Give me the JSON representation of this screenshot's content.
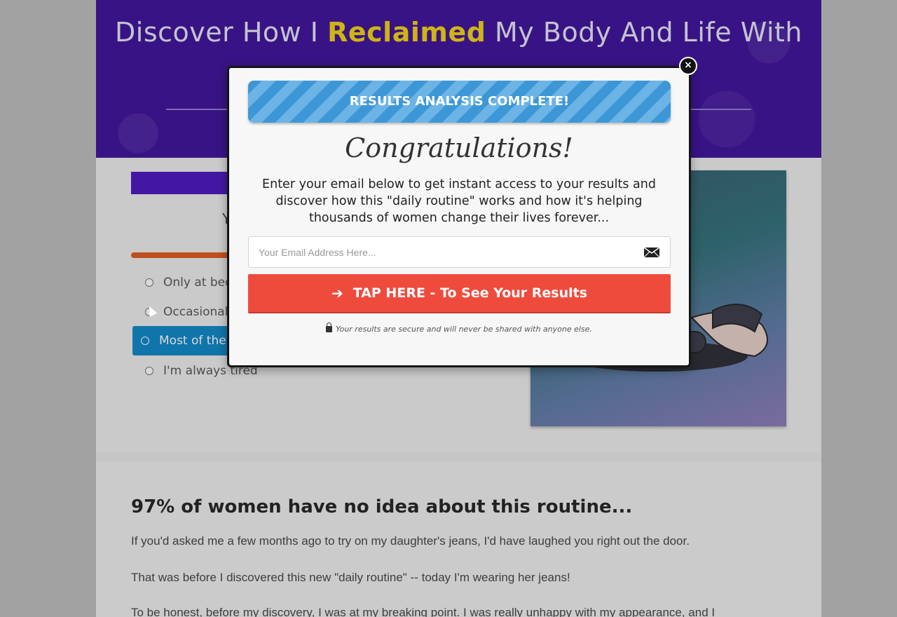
{
  "hero": {
    "title_pre": "Discover How I ",
    "title_highlight": "Reclaimed",
    "title_post": " My Body And Life With"
  },
  "quiz": {
    "question_fragment": "Y",
    "options": [
      {
        "label": "Only at bed",
        "selected": false
      },
      {
        "label": "Occasional",
        "selected": false
      },
      {
        "label": "Most of the",
        "selected": true
      },
      {
        "label": "I'm always tired",
        "selected": false
      }
    ]
  },
  "article": {
    "title": "97% of women have no idea about this routine...",
    "paragraphs": [
      "If you'd asked me a few months ago to try on my daughter's jeans, I'd have laughed you right out the door.",
      "That was before I discovered this new \"daily routine\" -- today I'm wearing her jeans!",
      "To be honest, before my discovery, I was at my breaking point. I was really unhappy with my appearance, and I"
    ]
  },
  "modal": {
    "close_label": "×",
    "banner": "RESULTS ANALYSIS COMPLETE!",
    "heading": "Congratulations!",
    "description": "Enter your email below to get instant access to your results and discover how this \"daily routine\" works and how it's helping thousands of women change their lives forever...",
    "email_placeholder": "Your Email Address Here...",
    "email_value": "",
    "cta_label": "TAP HERE - To See Your Results",
    "secure_note": "Your results are secure and will never be shared with anyone else."
  },
  "colors": {
    "hero_bg": "#3c0f9a",
    "highlight": "#f5d40f",
    "banner_blue": "#3d97d6",
    "cta_red": "#ef4b3d",
    "selected_option": "#0b87c9"
  },
  "icons": [
    "close-icon",
    "envelope-icon",
    "arrow-right-icon",
    "lock-icon",
    "radio-icon"
  ]
}
